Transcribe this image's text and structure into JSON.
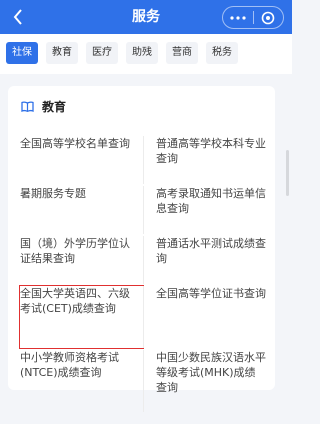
{
  "header": {
    "title": "服务"
  },
  "tabs": [
    "社保",
    "教育",
    "医疗",
    "助残",
    "营商",
    "税务"
  ],
  "section": {
    "title": "教育",
    "items": [
      [
        "全国高等学校名单查询",
        "普通高等学校本科专业查询"
      ],
      [
        "暑期服务专题",
        "高考录取通知书运单信息查询"
      ],
      [
        "国（境）外学历学位认证结果查询",
        "普通话水平测试成绩查询"
      ],
      [
        "全国大学英语四、六级考试(CET)成绩查询",
        "全国高等学位证书查询"
      ],
      [
        "中小学教师资格考试(NTCE)成绩查询",
        "中国少数民族汉语水平等级考试(MHK)成绩查询"
      ]
    ]
  },
  "colors": {
    "brand": "#2f71e8",
    "highlight": "#e03030"
  }
}
